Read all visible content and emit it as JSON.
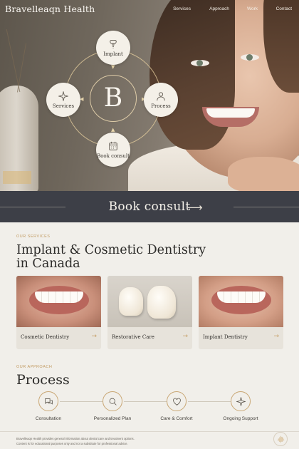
{
  "nav": {
    "brand": "Bravelleaqn Health",
    "links": [
      "Services",
      "Approach",
      "Work",
      "Contact"
    ]
  },
  "hero": {
    "monogram": "B",
    "nodes": {
      "top": "Implant",
      "left": "Services",
      "right": "Process",
      "bottom": "Book consult"
    }
  },
  "cta": {
    "label": "Book consult"
  },
  "services": {
    "eyebrow": "OUR SERVICES",
    "title_line1": "Implant & Cosmetic Dentistry",
    "title_line2": "in Canada",
    "cards": [
      {
        "label": "Cosmetic Dentistry"
      },
      {
        "label": "Restorative Care"
      },
      {
        "label": "Implant Dentistry"
      }
    ]
  },
  "approach": {
    "eyebrow": "OUR APPROACH",
    "title": "Process",
    "steps": [
      {
        "label": "Consultation",
        "icon": "chat-icon"
      },
      {
        "label": "Personalized Plan",
        "icon": "search-icon"
      },
      {
        "label": "Care & Comfort",
        "icon": "heart-icon"
      },
      {
        "label": "Ongoing Support",
        "icon": "sparkle-icon"
      }
    ]
  },
  "footer": {
    "disclaimer_line1": "Bravelleaqn Health provides general information about dental care and treatment options.",
    "disclaimer_line2": "Content is for educational purposes only and not a substitute for professional advice."
  },
  "colors": {
    "accent": "#c29c64",
    "cta_bg": "#3d3f47",
    "page_bg": "#f1efea"
  }
}
